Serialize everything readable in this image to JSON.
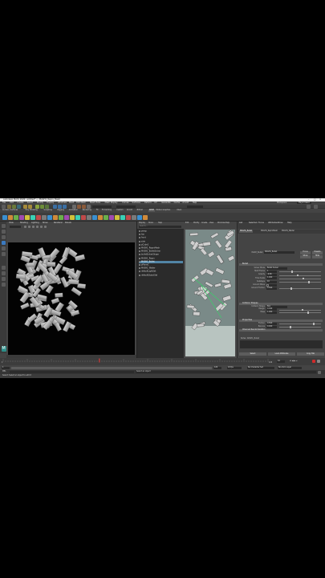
{
  "window": {
    "title": "Autodesk MAYA 2020: untitled* --- MASH1_Repro_Mesh"
  },
  "menubar": [
    "File",
    "Edit",
    "Create",
    "Select",
    "Modify",
    "Display",
    "Windows",
    "Mesh",
    "Edit Mesh",
    "Mesh Tools",
    "Mesh Display",
    "Curves",
    "Surfaces",
    "Deform",
    "UV",
    "Generate",
    "Cache",
    "Arnold",
    "Help"
  ],
  "menubar_right": {
    "workspace_label": "Workspace:",
    "workspace_value": "Maya Classic"
  },
  "shelf_tabs": [
    "Curves / Surfaces",
    "Poly Modeling",
    "Sculpting",
    "Rigging",
    "Animation",
    "Rendering",
    "FX",
    "FX Caching",
    "Custom",
    "Arnold",
    "Bifrost",
    "MASH",
    "Motion Graphics",
    "XGen"
  ],
  "viewport_menu": [
    "View",
    "Shading",
    "Lighting",
    "Show",
    "Renderer",
    "Panels"
  ],
  "outliner": {
    "menu": [
      "Display",
      "Show",
      "Help"
    ],
    "search_placeholder": "Search...",
    "items": [
      {
        "label": "persp",
        "selected": false
      },
      {
        "label": "top",
        "selected": false
      },
      {
        "label": "front",
        "selected": false
      },
      {
        "label": "side",
        "selected": false
      },
      {
        "label": "pCube1",
        "selected": false
      },
      {
        "label": "MASH1_ReproMesh",
        "selected": false
      },
      {
        "label": "MASH1_BulletSolver",
        "selected": false
      },
      {
        "label": "bulletSolverShape",
        "selected": false
      },
      {
        "label": "MASH1_Repro",
        "selected": false
      },
      {
        "label": "MASH1_Bullet",
        "selected": true
      },
      {
        "label": "pPlane1",
        "selected": false
      },
      {
        "label": "MASH1_Waiter",
        "selected": false
      },
      {
        "label": "defaultLightSet",
        "selected": false
      },
      {
        "label": "defaultObjectSet",
        "selected": false
      }
    ]
  },
  "nodeview_menu": [
    "Edit",
    "Modify",
    "Create",
    "View",
    "Windows",
    "Help"
  ],
  "attribute_editor": {
    "menu": [
      "List",
      "Selected",
      "Focus",
      "Attributes",
      "Show",
      "Help"
    ],
    "tabs": [
      "MASH1_Bullet",
      "MASH1_ReproMesh",
      "MASH1_Waiter"
    ],
    "node_label": "MASH_Bullet:",
    "node_value": "MASH1_Bullet",
    "buttons": [
      "Focus",
      "Presets",
      "Show",
      "Hide"
    ],
    "sections": [
      "Bullet",
      "Collision Shapes",
      "Properties",
      "Channel Randomization"
    ],
    "rows": [
      {
        "label": "Solver Mode",
        "value": "Bullet Solver"
      },
      {
        "label": "Start Frame",
        "value": "1"
      },
      {
        "label": "Gravity",
        "value": "-9.80"
      },
      {
        "label": "Time Scale",
        "value": "1.000"
      },
      {
        "label": "Substeps",
        "value": "10"
      },
      {
        "label": "Ground Plane",
        "value": ""
      },
      {
        "label": "Ground Friction",
        "value": "0.500"
      },
      {
        "label": "Collision Shape",
        "value": "Box"
      },
      {
        "label": "Margin",
        "value": "0.040"
      },
      {
        "label": "Mass",
        "value": "1.000"
      },
      {
        "label": "Friction",
        "value": "0.500"
      },
      {
        "label": "Bounce",
        "value": "0.000"
      }
    ],
    "bottom_buttons": [
      "Select",
      "Load Attributes",
      "Copy Tab"
    ],
    "notes_label": "Notes: MASH1_Bullet"
  },
  "timeline": {
    "start": "1",
    "end": "120",
    "current": "44"
  },
  "range": {
    "min": "1",
    "max": "120",
    "fps": "24 fps",
    "anim_layer": "No Anim Layer",
    "char_set": "No Character Set"
  },
  "cmdline": {
    "label": "MEL",
    "output": "Select an object"
  },
  "helpline": {
    "text": "Select: Select an object to edit it"
  },
  "colors": {
    "accent": "#5285a6",
    "bg": "#444444",
    "viewport": "#030303"
  }
}
